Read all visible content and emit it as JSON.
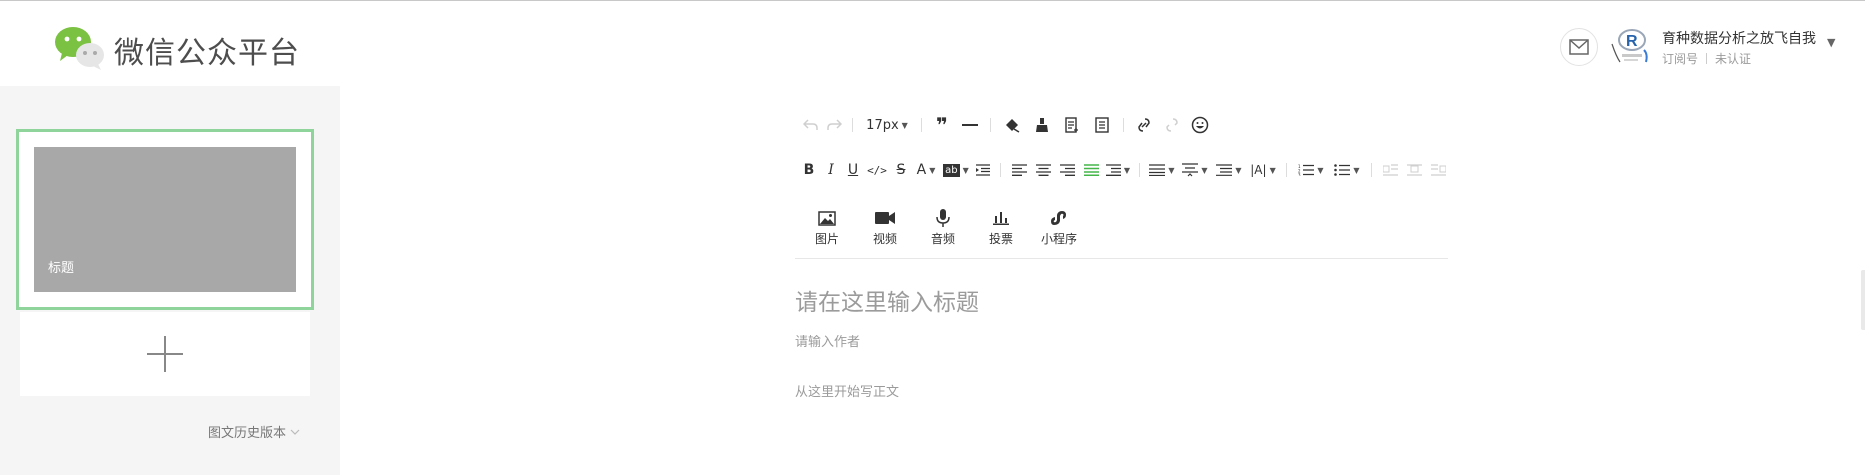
{
  "header": {
    "brand": "微信公众平台",
    "account": {
      "name": "育种数据分析之放飞自我",
      "type": "订阅号",
      "verify": "未认证"
    }
  },
  "left": {
    "article": {
      "cover_title": "标题"
    },
    "history": "图文历史版本"
  },
  "toolbar": {
    "font_size": "17px"
  },
  "insert": [
    {
      "label": "图片",
      "icon": "image-icon"
    },
    {
      "label": "视频",
      "icon": "video-icon"
    },
    {
      "label": "音频",
      "icon": "microphone-icon"
    },
    {
      "label": "投票",
      "icon": "poll-icon"
    },
    {
      "label": "小程序",
      "icon": "miniprogram-icon"
    }
  ],
  "editor": {
    "title_placeholder": "请在这里输入标题",
    "author_placeholder": "请输入作者",
    "body_placeholder": "从这里开始写正文"
  },
  "colors": {
    "accent_green": "#8fd49a",
    "wechat_green": "#7bc142",
    "active_align": "#44b549"
  }
}
